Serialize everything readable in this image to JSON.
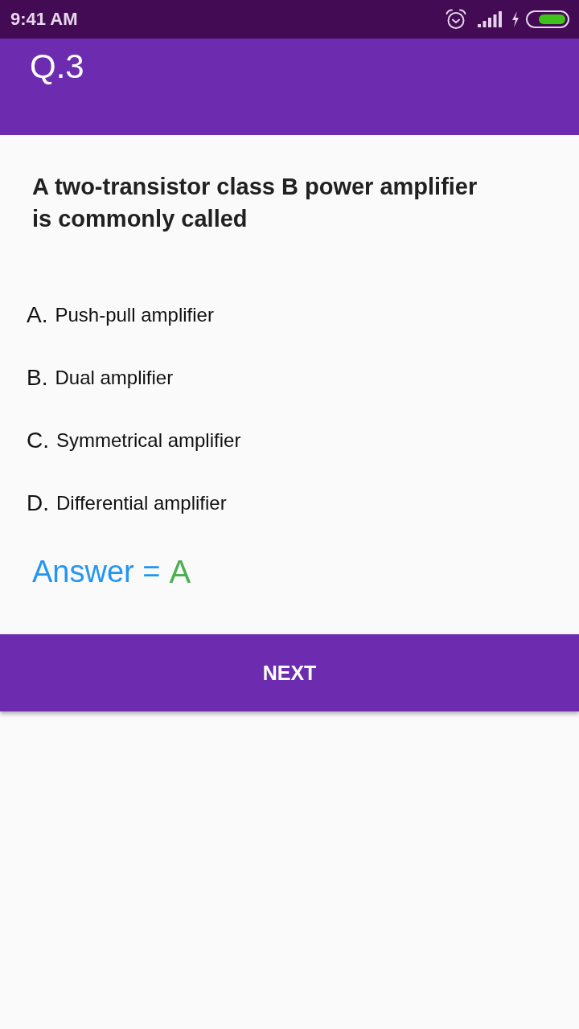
{
  "status_bar": {
    "time": "9:41 AM"
  },
  "header": {
    "title": "Q.3"
  },
  "question": "A two-transistor class B power amplifier is commonly called",
  "options": [
    {
      "letter": "A.",
      "text": "Push-pull amplifier"
    },
    {
      "letter": "B.",
      "text": "Dual amplifier"
    },
    {
      "letter": "C.",
      "text": "Symmetrical amplifier"
    },
    {
      "letter": "D.",
      "text": "Differential amplifier"
    }
  ],
  "answer": {
    "label": "Answer =",
    "value": "A"
  },
  "next_button": {
    "label": "NEXT"
  }
}
